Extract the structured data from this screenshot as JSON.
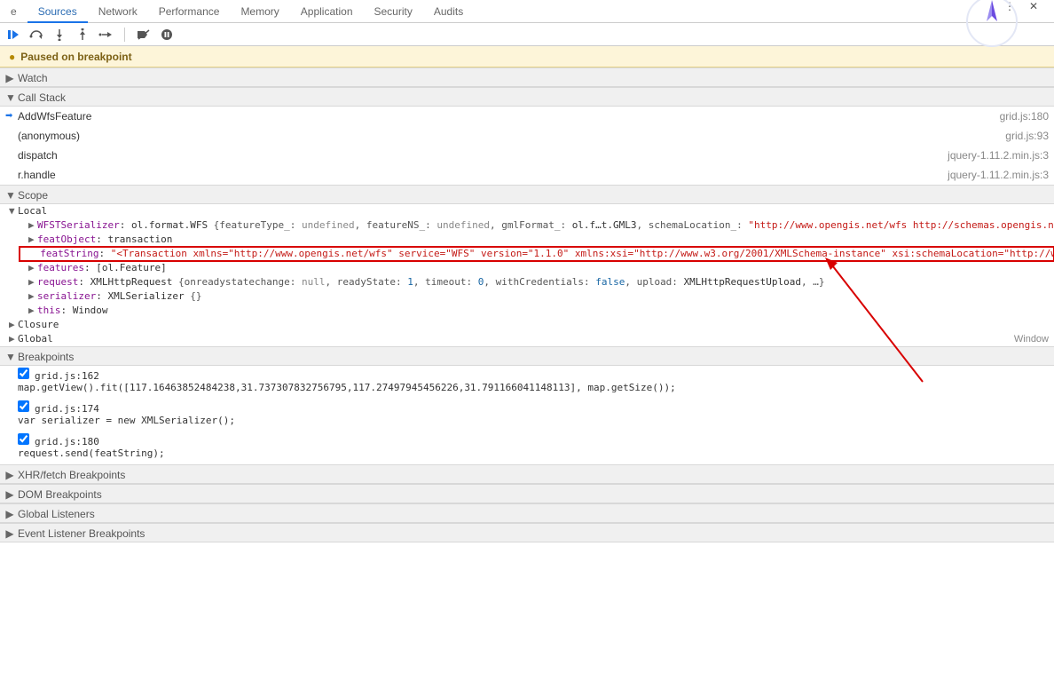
{
  "tabs": {
    "pre": "e",
    "items": [
      "Sources",
      "Network",
      "Performance",
      "Memory",
      "Application",
      "Security",
      "Audits"
    ],
    "active": 0
  },
  "paused": {
    "label": "Paused on breakpoint"
  },
  "sections": {
    "watch": "Watch",
    "callstack": "Call Stack",
    "scope": "Scope",
    "breakpoints": "Breakpoints",
    "xhr": "XHR/fetch Breakpoints",
    "dom": "DOM Breakpoints",
    "global": "Global Listeners",
    "event": "Event Listener Breakpoints",
    "closure": "Closure",
    "globalsc": "Global",
    "local": "Local"
  },
  "callstack": [
    {
      "name": "AddWfsFeature",
      "loc": "grid.js:180",
      "active": true
    },
    {
      "name": "(anonymous)",
      "loc": "grid.js:93"
    },
    {
      "name": "dispatch",
      "loc": "jquery-1.11.2.min.js:3"
    },
    {
      "name": "r.handle",
      "loc": "jquery-1.11.2.min.js:3"
    }
  ],
  "scope": {
    "wfstLabel": "WFSTSerializer",
    "wfstClass": "ol.format.WFS",
    "wfstBody": " {featureType_: ",
    "undef": "undefined",
    "wfstBody2": ", featureNS_: ",
    "wfstBody3": ", gmlFormat_: ",
    "gml": "ol.f…t.GML3",
    "wfstBody4": ", schemaLocation_: ",
    "schemaStr": "\"http://www.opengis.net/wfs http://schemas.opengis.net/",
    "featObj": "featObject",
    "transaction": "transaction",
    "featStringK": "featString",
    "featStringV": "\"<Transaction xmlns=\"http://www.opengis.net/wfs\" service=\"WFS\" version=\"1.1.0\" xmlns:xsi=\"http://www.w3.org/2001/XMLSchema-instance\" xsi:schemaLocation=\"http://www.",
    "featuresK": "features",
    "featuresV": "[ol.Feature]",
    "requestK": "request",
    "requestCls": "XMLHttpRequest",
    "requestBody": " {onreadystatechange: ",
    "nul": "null",
    "requestBody2": ", readyState: ",
    "one": "1",
    "requestBody3": ", timeout: ",
    "zero": "0",
    "requestBody4": ", withCredentials: ",
    "fls": "false",
    "requestBody5": ", upload: ",
    "upload": "XMLHttpRequestUpload",
    "requestBody6": ", …}",
    "serializerK": "serializer",
    "serializerCls": "XMLSerializer",
    "serializerBody": " {}",
    "thisK": "this",
    "thisV": "Window",
    "globalWindow": "Window"
  },
  "breakpoints": [
    {
      "loc": "grid.js:162",
      "code": "map.getView().fit([117.16463852484238,31.737307832756795,117.27497945456226,31.791166041148113], map.getSize());"
    },
    {
      "loc": "grid.js:174",
      "code": "var serializer = new XMLSerializer();"
    },
    {
      "loc": "grid.js:180",
      "code": "request.send(featString);"
    }
  ]
}
